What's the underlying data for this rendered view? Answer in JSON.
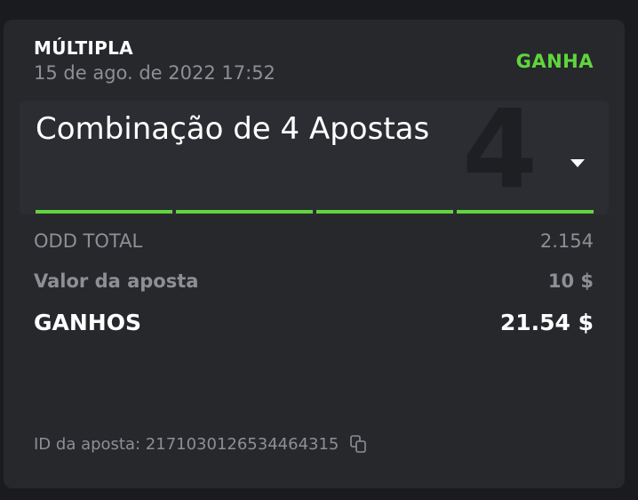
{
  "bet": {
    "type": "MÚLTIPLA",
    "date": "15 de ago. de 2022 17:52",
    "status": "GANHA",
    "combination_title": "Combinação de 4 Apostas",
    "selection_count": "4",
    "selections_won": 4,
    "selections_total": 4
  },
  "summary": {
    "odd_label": "ODD TOTAL",
    "odd_value": "2.154",
    "stake_label": "Valor da aposta",
    "stake_value": "10 $",
    "winnings_label": "GANHOS",
    "winnings_value": "21.54 $"
  },
  "footer": {
    "bet_id_label": "ID da aposta: 2171030126534464315",
    "copy_icon": "copy-icon"
  },
  "colors": {
    "background": "#1a1b1e",
    "card": "#27282c",
    "win_accent": "#5fd63c",
    "muted_text": "#8d8f95"
  }
}
